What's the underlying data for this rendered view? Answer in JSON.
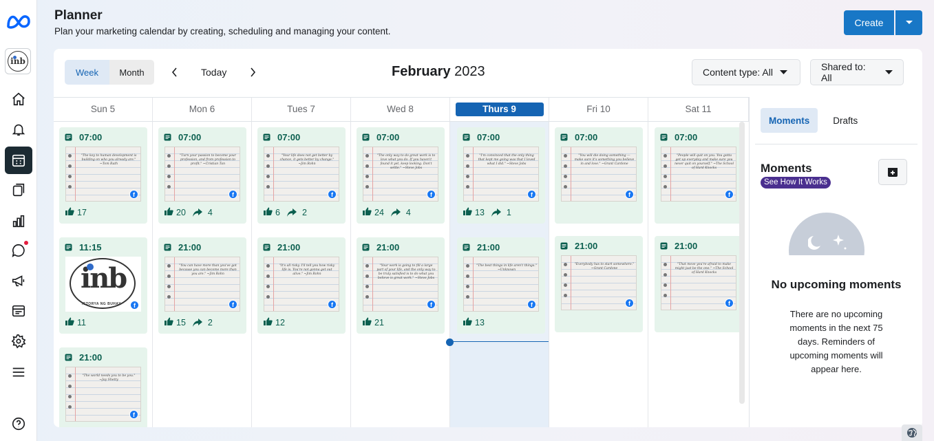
{
  "header": {
    "title": "Planner",
    "subtitle": "Plan your marketing calendar by creating, scheduling and managing your content.",
    "create_label": "Create"
  },
  "toolbar": {
    "week_label": "Week",
    "month_label": "Month",
    "today_label": "Today",
    "month_name": "February",
    "year": "2023",
    "content_type_label": "Content type: All",
    "shared_to_label": "Shared to: All"
  },
  "days": [
    {
      "label": "Sun 5"
    },
    {
      "label": "Mon 6"
    },
    {
      "label": "Tues 7"
    },
    {
      "label": "Wed 8"
    },
    {
      "label": "Thurs 9",
      "today": true
    },
    {
      "label": "Fri 10"
    },
    {
      "label": "Sat 11"
    }
  ],
  "posts": [
    {
      "day": 0,
      "slot": 0,
      "time": "07:00",
      "likes": "17",
      "shares": "",
      "quote": "\"The key to human development is building on who you already are.\" ~Tom Rath"
    },
    {
      "day": 0,
      "slot": 1,
      "time": "11:15",
      "likes": "11",
      "shares": "",
      "logo": true,
      "logo_text": "inb",
      "logo_caption": "ISTORYA NG BUHAY"
    },
    {
      "day": 0,
      "slot": 2,
      "time": "21:00",
      "likes": "",
      "shares": "",
      "quote": "\"The world needs you to be you.\" ~Jay Shetty"
    },
    {
      "day": 1,
      "slot": 0,
      "time": "07:00",
      "likes": "20",
      "shares": "4",
      "quote": "\"Turn your passion to become your profession, and from profession to profit.\" ~Cristian Tan"
    },
    {
      "day": 1,
      "slot": 1,
      "time": "21:00",
      "likes": "15",
      "shares": "2",
      "quote": "\"You can have more than you've got because you can become more than you are.\" ~Jim Rohn"
    },
    {
      "day": 2,
      "slot": 0,
      "time": "07:00",
      "likes": "6",
      "shares": "2",
      "quote": "\"Your life does not get better by chance, it gets better by change.\" ~Jim Rohn"
    },
    {
      "day": 2,
      "slot": 1,
      "time": "21:00",
      "likes": "12",
      "shares": "",
      "quote": "\"It's all risky. I'll tell you how risky life is. You're not gonna get out alive.\" ~Jim Rohn"
    },
    {
      "day": 3,
      "slot": 0,
      "time": "07:00",
      "likes": "24",
      "shares": "4",
      "quote": "\"The only way to do great work is to love what you do. If you haven't found it yet, keep looking. Don't settle.\" ~Steve Jobs"
    },
    {
      "day": 3,
      "slot": 1,
      "time": "21:00",
      "likes": "21",
      "shares": "",
      "quote": "\"Your work is going to fill a large part of your life, and the only way to be truly satisfied is to do what you believe is great work.\" ~Steve Jobs"
    },
    {
      "day": 4,
      "slot": 0,
      "time": "07:00",
      "likes": "13",
      "shares": "1",
      "quote": "\"I'm convinced that the only thing that kept me going was that I loved what I did.\" ~Steve Jobs"
    },
    {
      "day": 4,
      "slot": 1,
      "time": "21:00",
      "likes": "13",
      "shares": "",
      "quote": "\"The best things in life aren't things.\" ~Unknown"
    },
    {
      "day": 5,
      "slot": 0,
      "time": "07:00",
      "likes": "",
      "shares": "",
      "quote": "\"You will die doing something — make sure it's something you believe in and love.\" ~Grant Cardone"
    },
    {
      "day": 5,
      "slot": 1,
      "time": "21:00",
      "likes": "",
      "shares": "",
      "quote": "\"Everybody has to start somewhere.\" ~Grant Cardone"
    },
    {
      "day": 6,
      "slot": 0,
      "time": "07:00",
      "likes": "",
      "shares": "",
      "quote": "\"People will quit on you. You gotta get up everyday and make sure you never quit on yourself.\" ~The School of Hard Knocks"
    },
    {
      "day": 6,
      "slot": 1,
      "time": "21:00",
      "likes": "",
      "shares": "",
      "quote": "\"That move you're afraid to make might just be the one.\" ~The School of Hard Knocks"
    }
  ],
  "right": {
    "tab_moments": "Moments",
    "tab_drafts": "Drafts",
    "moments_title": "Moments",
    "how_it_works": "See How It Works",
    "empty_title": "No upcoming moments",
    "empty_body": "There are no upcoming moments in the next 75 days. Reminders of upcoming moments will appear here."
  },
  "colors": {
    "accent": "#1564b3",
    "card_bg": "#e6f4ec",
    "card_text": "#0b5f4f",
    "badge_purple": "#4a2f8f"
  },
  "icons": [
    "meta-logo-icon",
    "home-icon",
    "bell-icon",
    "calendar-icon",
    "pages-icon",
    "insights-icon",
    "chat-icon",
    "megaphone-icon",
    "browser-icon",
    "gear-icon",
    "menu-icon",
    "help-icon",
    "globe-icon"
  ]
}
